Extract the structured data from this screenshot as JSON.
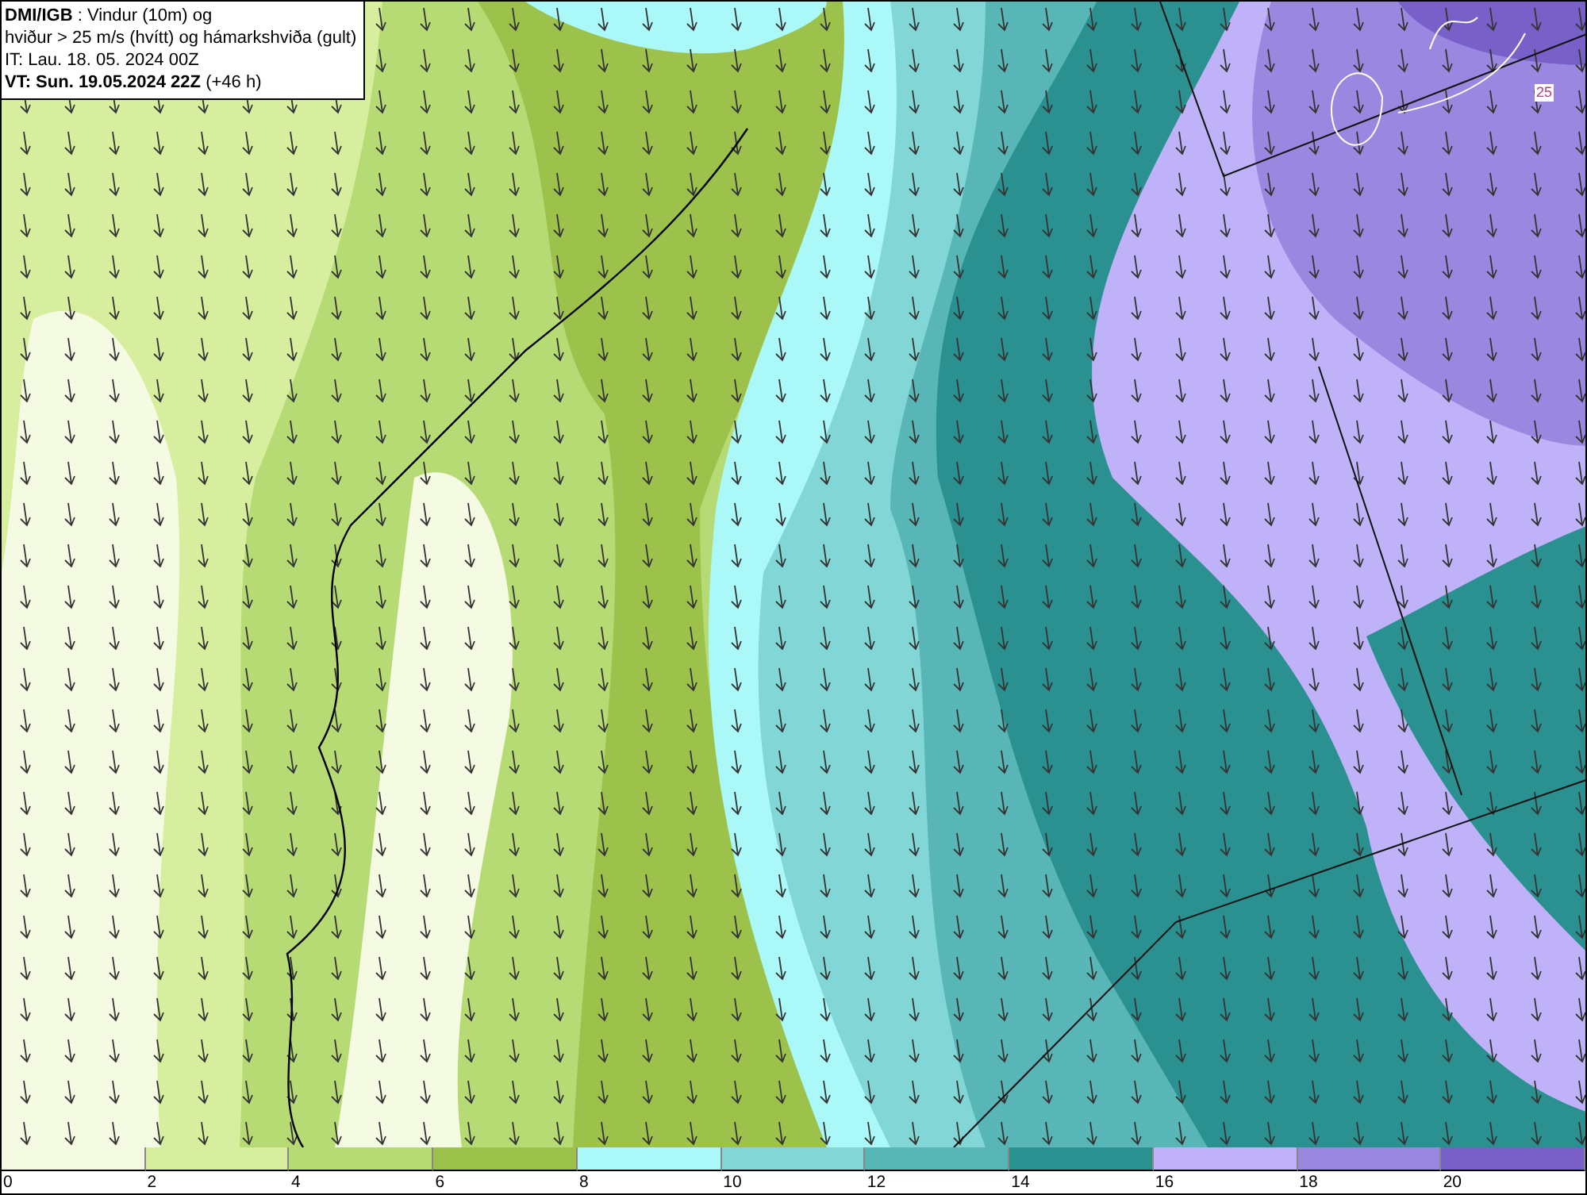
{
  "info_box": {
    "lines": [
      "**DMI/IGB** : Vindur (10m) og",
      "hviður > 25 m/s (hvítt) og hámarkshviða (gult)",
      "IT: Lau. 18. 05. 2024 00Z",
      "**VT: Sun. 19.05.2024 22Z** (+46 h)"
    ]
  },
  "map": {
    "contour_label": "25"
  },
  "legend": [
    {
      "label": "0",
      "color": "#f4fbe2"
    },
    {
      "label": "2",
      "color": "#d6ee9e"
    },
    {
      "label": "4",
      "color": "#b6da74"
    },
    {
      "label": "6",
      "color": "#9cc24c"
    },
    {
      "label": "8",
      "color": "#aaf8f8"
    },
    {
      "label": "10",
      "color": "#82d6d6"
    },
    {
      "label": "12",
      "color": "#58b6b6"
    },
    {
      "label": "14",
      "color": "#2a9090"
    },
    {
      "label": "16",
      "color": "#c0b2f8"
    },
    {
      "label": "18",
      "color": "#9a88e0"
    },
    {
      "label": "20",
      "color": "#7860c8"
    }
  ]
}
